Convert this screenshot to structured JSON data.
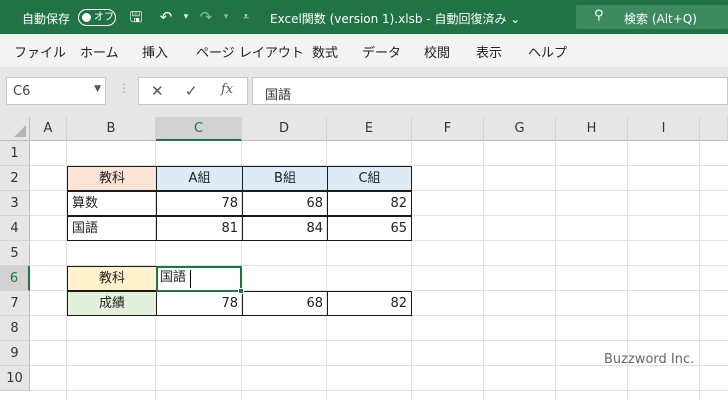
{
  "titlebar": {
    "autosave_label": "自動保存",
    "autosave_state": "オフ",
    "title": "Excel関数 (version 1).xlsb  -  自動回復済み  ⌄",
    "search_placeholder": "検索 (Alt+Q)"
  },
  "ribbon": {
    "tabs": [
      "ファイル",
      "ホーム",
      "挿入",
      "ページ レイアウト",
      "数式",
      "データ",
      "校閲",
      "表示",
      "ヘルプ"
    ]
  },
  "formula_bar": {
    "name_box": "C6",
    "fx_label": "fx",
    "value": "国語"
  },
  "sheet": {
    "columns": [
      "A",
      "B",
      "C",
      "D",
      "E",
      "F",
      "G",
      "H",
      "I"
    ],
    "rows": [
      "1",
      "2",
      "3",
      "4",
      "5",
      "6",
      "7",
      "8",
      "9",
      "10"
    ],
    "cells": {
      "B2": "教科",
      "C2": "A組",
      "D2": "B組",
      "E2": "C組",
      "B3": "算数",
      "C3": "78",
      "D3": "68",
      "E3": "82",
      "B4": "国語",
      "C4": "81",
      "D4": "84",
      "E4": "65",
      "B6": "教科",
      "C6": "国語",
      "B7": "成績",
      "C7": "78",
      "D7": "68",
      "E7": "82"
    },
    "colors": {
      "header_peach": "#fce4d6",
      "header_blue": "#ddebf7",
      "label_yellow": "#fff2cc",
      "label_green": "#e2efda",
      "accent": "#217346"
    }
  },
  "watermark": "Buzzword Inc."
}
